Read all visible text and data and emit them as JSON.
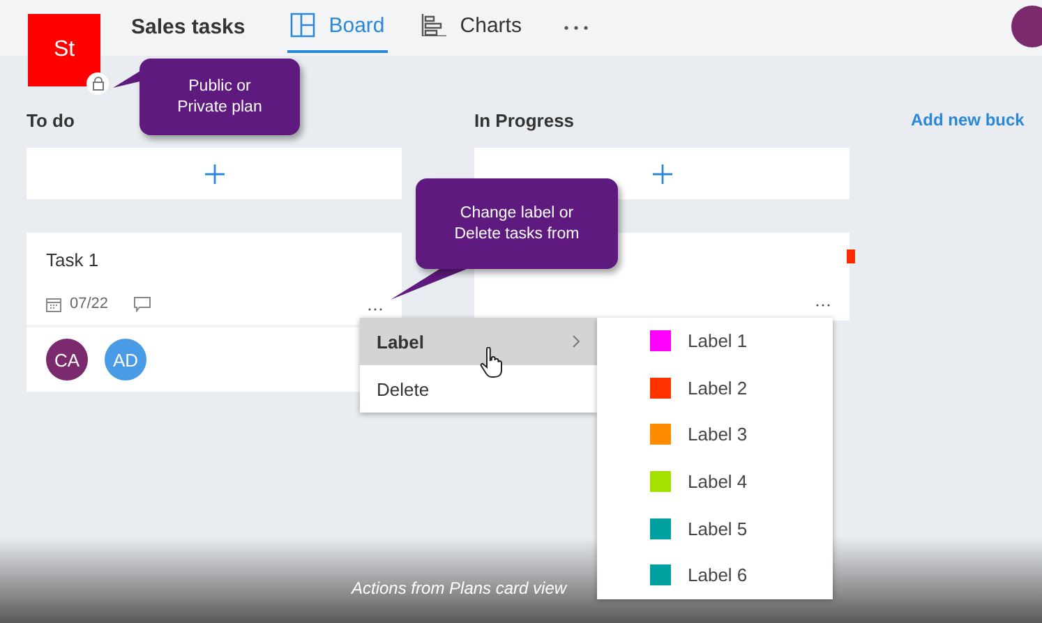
{
  "plan": {
    "initials": "St",
    "title": "Sales tasks"
  },
  "tabs": [
    {
      "label": "Board",
      "kind": "board",
      "selected": true
    },
    {
      "label": "Charts",
      "kind": "charts",
      "selected": false
    }
  ],
  "buckets": [
    {
      "name": "To do",
      "tasks": [
        {
          "title": "Task 1",
          "due": "07/22",
          "assignees": [
            {
              "initials": "CA",
              "color": "#7b2a6e"
            },
            {
              "initials": "AD",
              "color": "#4a9be6"
            }
          ]
        }
      ]
    },
    {
      "name": "In Progress",
      "tasks": [
        {
          "color": "#ff2a00"
        }
      ]
    }
  ],
  "add_bucket": "Add new buck",
  "context_menu": [
    {
      "label": "Label",
      "has_submenu": true,
      "selected": true
    },
    {
      "label": "Delete",
      "has_submenu": false,
      "selected": false
    }
  ],
  "label_menu": [
    {
      "label": "Label 1",
      "color": "#ff00ff"
    },
    {
      "label": "Label 2",
      "color": "#ff3300"
    },
    {
      "label": "Label 3",
      "color": "#ff8c00"
    },
    {
      "label": "Label 4",
      "color": "#a4e000"
    },
    {
      "label": "Label 5",
      "color": "#00a0a0"
    },
    {
      "label": "Label 6",
      "color": "#00a0a0"
    }
  ],
  "callouts": [
    {
      "text": "Public or Private plan",
      "kind": "lock"
    },
    {
      "text": "Change label or Delete tasks from",
      "kind": "card"
    }
  ],
  "caption": "Actions from Plans card view"
}
